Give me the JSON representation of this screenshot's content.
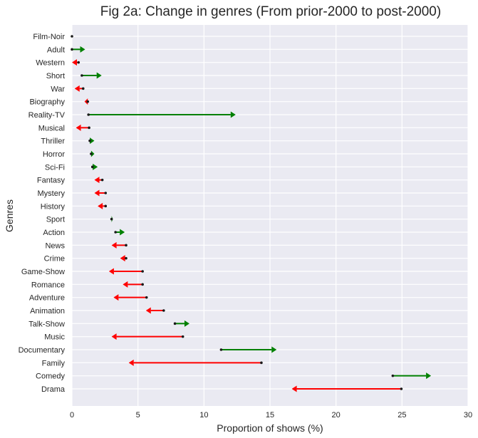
{
  "chart_data": {
    "type": "arrow-dumbbell",
    "title": "Fig 2a: Change in genres (From prior-2000 to post-2000)",
    "xlabel": "Proportion of shows (%)",
    "ylabel": "Genres",
    "xlim": [
      0,
      30
    ],
    "xticks": [
      "0",
      "5",
      "10",
      "15",
      "20",
      "25",
      "30"
    ],
    "xtick_values": [
      0,
      5,
      10,
      15,
      20,
      25,
      30
    ],
    "grid": true,
    "colors": {
      "background": "#eaeaf2",
      "grid": "#ffffff",
      "increase": "#008000",
      "decrease": "#ff0000",
      "start_marker": "#1a1a1a"
    },
    "series": [
      {
        "genre": "Film-Noir",
        "prior_2000": 0.0,
        "post_2000": 0.0
      },
      {
        "genre": "Adult",
        "prior_2000": 0.0,
        "post_2000": 1.0
      },
      {
        "genre": "Western",
        "prior_2000": 0.5,
        "post_2000": 0.0
      },
      {
        "genre": "Short",
        "prior_2000": 0.75,
        "post_2000": 2.25
      },
      {
        "genre": "War",
        "prior_2000": 0.85,
        "post_2000": 0.2
      },
      {
        "genre": "Biography",
        "prior_2000": 1.2,
        "post_2000": 0.95
      },
      {
        "genre": "Reality-TV",
        "prior_2000": 1.25,
        "post_2000": 12.4
      },
      {
        "genre": "Musical",
        "prior_2000": 1.3,
        "post_2000": 0.3
      },
      {
        "genre": "Thriller",
        "prior_2000": 1.35,
        "post_2000": 1.7
      },
      {
        "genre": "Horror",
        "prior_2000": 1.45,
        "post_2000": 1.7
      },
      {
        "genre": "Sci-Fi",
        "prior_2000": 1.55,
        "post_2000": 1.95
      },
      {
        "genre": "Fantasy",
        "prior_2000": 2.3,
        "post_2000": 1.7
      },
      {
        "genre": "Mystery",
        "prior_2000": 2.55,
        "post_2000": 1.7
      },
      {
        "genre": "History",
        "prior_2000": 2.55,
        "post_2000": 1.95
      },
      {
        "genre": "Sport",
        "prior_2000": 3.0,
        "post_2000": 3.1
      },
      {
        "genre": "Action",
        "prior_2000": 3.3,
        "post_2000": 4.0
      },
      {
        "genre": "News",
        "prior_2000": 4.1,
        "post_2000": 3.0
      },
      {
        "genre": "Crime",
        "prior_2000": 4.1,
        "post_2000": 3.65
      },
      {
        "genre": "Game-Show",
        "prior_2000": 5.35,
        "post_2000": 2.8
      },
      {
        "genre": "Romance",
        "prior_2000": 5.35,
        "post_2000": 3.85
      },
      {
        "genre": "Adventure",
        "prior_2000": 5.65,
        "post_2000": 3.15
      },
      {
        "genre": "Animation",
        "prior_2000": 6.95,
        "post_2000": 5.6
      },
      {
        "genre": "Talk-Show",
        "prior_2000": 7.8,
        "post_2000": 8.9
      },
      {
        "genre": "Music",
        "prior_2000": 8.4,
        "post_2000": 3.0
      },
      {
        "genre": "Documentary",
        "prior_2000": 11.3,
        "post_2000": 15.5
      },
      {
        "genre": "Family",
        "prior_2000": 14.35,
        "post_2000": 4.3
      },
      {
        "genre": "Comedy",
        "prior_2000": 24.3,
        "post_2000": 27.2
      },
      {
        "genre": "Drama",
        "prior_2000": 24.95,
        "post_2000": 16.65
      }
    ]
  }
}
